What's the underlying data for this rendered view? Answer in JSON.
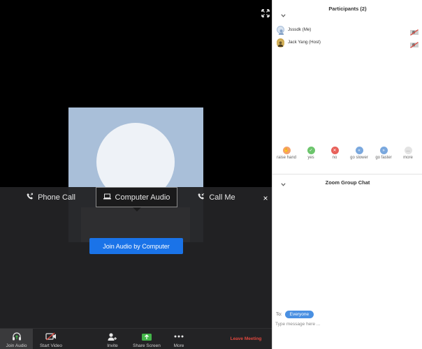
{
  "audio_panel": {
    "tabs": [
      {
        "label": "Phone Call",
        "icon": "phone-icon"
      },
      {
        "label": "Computer Audio",
        "icon": "laptop-icon"
      },
      {
        "label": "Call Me",
        "icon": "phone-callback-icon"
      }
    ],
    "selected_tab": "Computer Audio",
    "close_symbol": "×",
    "join_button": "Join Audio by Computer"
  },
  "toolbar": {
    "join_audio": "Join Audio",
    "start_video": "Start Video",
    "invite": "Invite",
    "share_screen": "Share Screen",
    "more": "More",
    "leave": "Leave Meeting"
  },
  "participants": {
    "title": "Participants (2)",
    "items": [
      {
        "name": "Jsssdk (Me)"
      },
      {
        "name": "Jack Yang (Host)"
      }
    ]
  },
  "reactions": [
    {
      "label": "raise hand",
      "icon": "raise-hand-icon",
      "color": "#f5a06a"
    },
    {
      "label": "yes",
      "icon": "yes-icon",
      "color": "#6cc56c"
    },
    {
      "label": "no",
      "icon": "no-icon",
      "color": "#e8615a"
    },
    {
      "label": "go slower",
      "icon": "go-slower-icon",
      "color": "#7aa8de"
    },
    {
      "label": "go faster",
      "icon": "go-faster-icon",
      "color": "#7aa8de"
    },
    {
      "label": "more",
      "icon": "more-icon",
      "color": "#c8c8c8"
    }
  ],
  "chat": {
    "title": "Zoom Group Chat",
    "to_label": "To:",
    "recipient": "Everyone",
    "placeholder": "Type message here ..."
  },
  "colors": {
    "accent": "#1a73e8",
    "leave": "#e0473e",
    "video_tile": "#a9bfd9",
    "share_green": "#43b549"
  }
}
